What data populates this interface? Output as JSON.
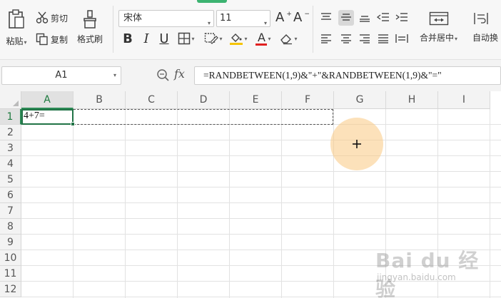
{
  "ribbon": {
    "paste_label": "粘贴",
    "cut_label": "剪切",
    "copy_label": "复制",
    "format_painter_label": "格式刷",
    "font_name": "宋体",
    "font_size": "11",
    "bold_label": "B",
    "italic_label": "I",
    "underline_label": "U",
    "font_color_label": "A",
    "grow_font_label": "A",
    "shrink_font_label": "A",
    "merge_center_label": "合并居中",
    "wrap_text_label": "自动换"
  },
  "formula_bar": {
    "name_box": "A1",
    "fx_label": "fx",
    "formula": "=RANDBETWEEN(1,9)&\"+\"&RANDBETWEEN(1,9)&\"=\""
  },
  "sheet": {
    "columns": [
      "A",
      "B",
      "C",
      "D",
      "E",
      "F",
      "G",
      "H",
      "I"
    ],
    "rows": [
      "1",
      "2",
      "3",
      "4",
      "5",
      "6",
      "7",
      "8",
      "9",
      "10",
      "11",
      "12"
    ],
    "active_cell_value": "4+7=",
    "selected_column": "A",
    "selected_row": "1"
  },
  "watermark": {
    "text": "Bai du 经验",
    "subtext": "jingyan.baidu.com"
  },
  "colors": {
    "accent": "#217346",
    "cursor_halo": "#fac882"
  }
}
